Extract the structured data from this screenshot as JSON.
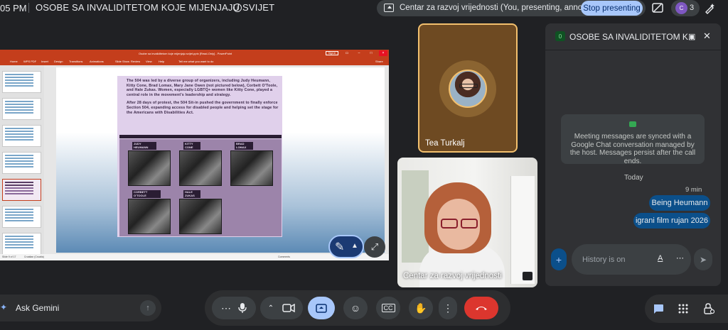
{
  "topbar": {
    "time": "05 PM",
    "meeting_title": "OSOBE SA INVALIDITETOM KOJE MIJENJAJU SVIJET",
    "presenting_text": "Centar za razvoj vrijednosti (You, presenting, annotating)",
    "stop_button": "Stop presenting",
    "people_count": "3",
    "avatar_letter": "C"
  },
  "presentation": {
    "window_title": "Osobe sa invaliditetom koje mijenjaju svijet.pptx [Read-Only] - PowerPoint",
    "sign_in": "Sign in",
    "ribbon_tabs": [
      "Home",
      "WPS PDF",
      "Insert",
      "Design",
      "Transitions",
      "Animations",
      "Slide Show",
      "Review",
      "View",
      "Help",
      "Tell me what you want to do",
      "Share"
    ],
    "slide_paragraph_1": "The 504 was led by a diverse group of organizers, including Judy Heumann, Kitty Cone, Brad Lomax, Mary Jane Owen (not pictured below), Corbett O'Toole, and Hale Zukas. Women, especially LGBTQ+ women like Kitty Cone, played a central role in the movement's leadership and strategy.",
    "slide_paragraph_2": "After 28 days of protest, the 504 Sit-in pushed the government to finally enforce Section 504, expanding access for disabled people and helping set the stage for the Americans with Disabilities Act.",
    "people": [
      {
        "label": "JUDY HEUMANN"
      },
      {
        "label": "KITTY CONE"
      },
      {
        "label": "BRAD LOMAX"
      },
      {
        "label": "CORBETT O'TOOLE"
      },
      {
        "label": "HALE ZUKAS"
      }
    ],
    "status_slide": "Slide 9 of 17",
    "status_lang": "Croatian (Croatia)",
    "status_comments": "Comments"
  },
  "tiles": {
    "tea_name": "Tea Turkalj",
    "centar_name": "Centar za razvoj vrijednosti"
  },
  "chat": {
    "title": "OSOBE SA INVALIDITETOM K...",
    "badge": "0",
    "sync_notice": "Meeting messages are synced with a Google Chat conversation managed by the host. Messages persist after the call ends.",
    "day_label": "Today",
    "time_label": "9 min",
    "messages": [
      "Being Heumann",
      "igrani film rujan 2026"
    ],
    "input_placeholder": "History is on"
  },
  "bottombar": {
    "gemini_label": "Ask Gemini"
  },
  "colors": {
    "accent": "#a8c7fa",
    "end_call": "#dc362e",
    "speaker_ring": "#f3c06e",
    "ppt_brand": "#c43e1c"
  }
}
